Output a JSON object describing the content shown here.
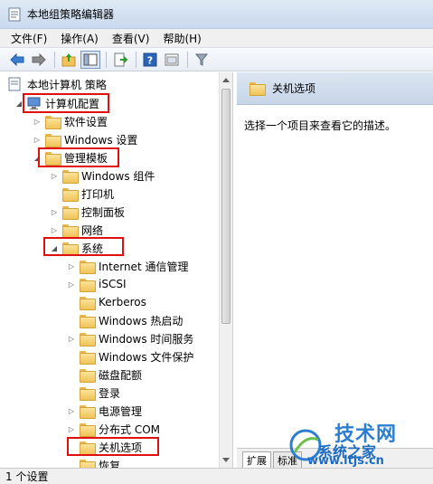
{
  "window": {
    "title": "本地组策略编辑器"
  },
  "menu": [
    "文件(F)",
    "操作(A)",
    "查看(V)",
    "帮助(H)"
  ],
  "tree": {
    "root": "本地计算机 策略",
    "items": [
      {
        "label": "计算机配置"
      },
      {
        "label": "软件设置"
      },
      {
        "label": "Windows 设置"
      },
      {
        "label": "管理模板"
      },
      {
        "label": "Windows 组件"
      },
      {
        "label": "打印机"
      },
      {
        "label": "控制面板"
      },
      {
        "label": "网络"
      },
      {
        "label": "系统"
      },
      {
        "label": "Internet 通信管理"
      },
      {
        "label": "iSCSI"
      },
      {
        "label": "Kerberos"
      },
      {
        "label": "Windows 热启动"
      },
      {
        "label": "Windows 时间服务"
      },
      {
        "label": "Windows 文件保护"
      },
      {
        "label": "磁盘配额"
      },
      {
        "label": "登录"
      },
      {
        "label": "电源管理"
      },
      {
        "label": "分布式 COM"
      },
      {
        "label": "关机选项"
      },
      {
        "label": "恢复"
      }
    ]
  },
  "right": {
    "header": "关机选项",
    "description": "选择一个项目来查看它的描述。",
    "tabs": [
      "扩展",
      "标准"
    ]
  },
  "status": "1 个设置",
  "watermark": {
    "top": "技术网",
    "mid": "系统之家",
    "url": "www.itjs.cn"
  },
  "colors": {
    "highlight": "#e01010",
    "header_bg": "#c6d5e8"
  }
}
